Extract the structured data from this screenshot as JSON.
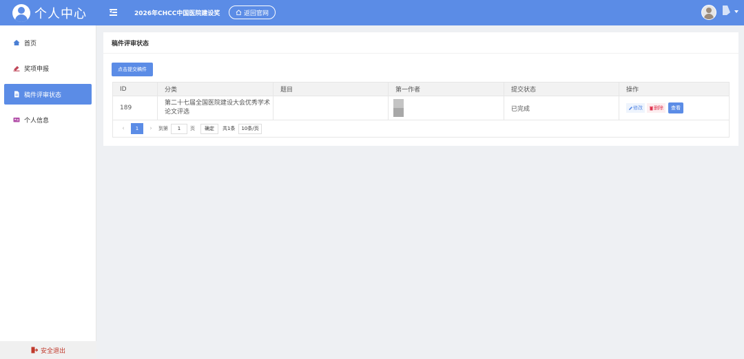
{
  "header": {
    "brand_title": "个人中心",
    "site_title": "2026年CHCC中国医院建设奖",
    "back_button": "返回官网"
  },
  "sidebar": {
    "items": [
      {
        "label": "首页",
        "icon": "home-icon",
        "active": false
      },
      {
        "label": "奖项申报",
        "icon": "award-icon",
        "active": false
      },
      {
        "label": "稿件评审状态",
        "icon": "document-icon",
        "active": true
      },
      {
        "label": "个人信息",
        "icon": "id-card-icon",
        "active": false
      }
    ],
    "logout_label": "安全退出"
  },
  "main": {
    "card_title": "稿件评审状态",
    "submit_button": "点击提交稿件",
    "table": {
      "columns": [
        "ID",
        "分类",
        "题目",
        "第一作者",
        "提交状态",
        "操作"
      ],
      "rows": [
        {
          "id": "189",
          "category": "第二十七届全国医院建设大会优秀学术论文评选",
          "title": "",
          "first_author": "",
          "status": "已完成",
          "actions": {
            "edit": "修改",
            "delete": "删除",
            "view": "查看"
          }
        }
      ]
    },
    "pagination": {
      "current_page": "1",
      "goto_prefix": "到第",
      "goto_value": "1",
      "goto_suffix": "页",
      "confirm": "确定",
      "total": "共1条",
      "page_size": "10条/页"
    }
  },
  "colors": {
    "primary": "#5b8ce6",
    "danger": "#e0344f",
    "logout": "#c0392b",
    "background": "#eef0f3"
  }
}
